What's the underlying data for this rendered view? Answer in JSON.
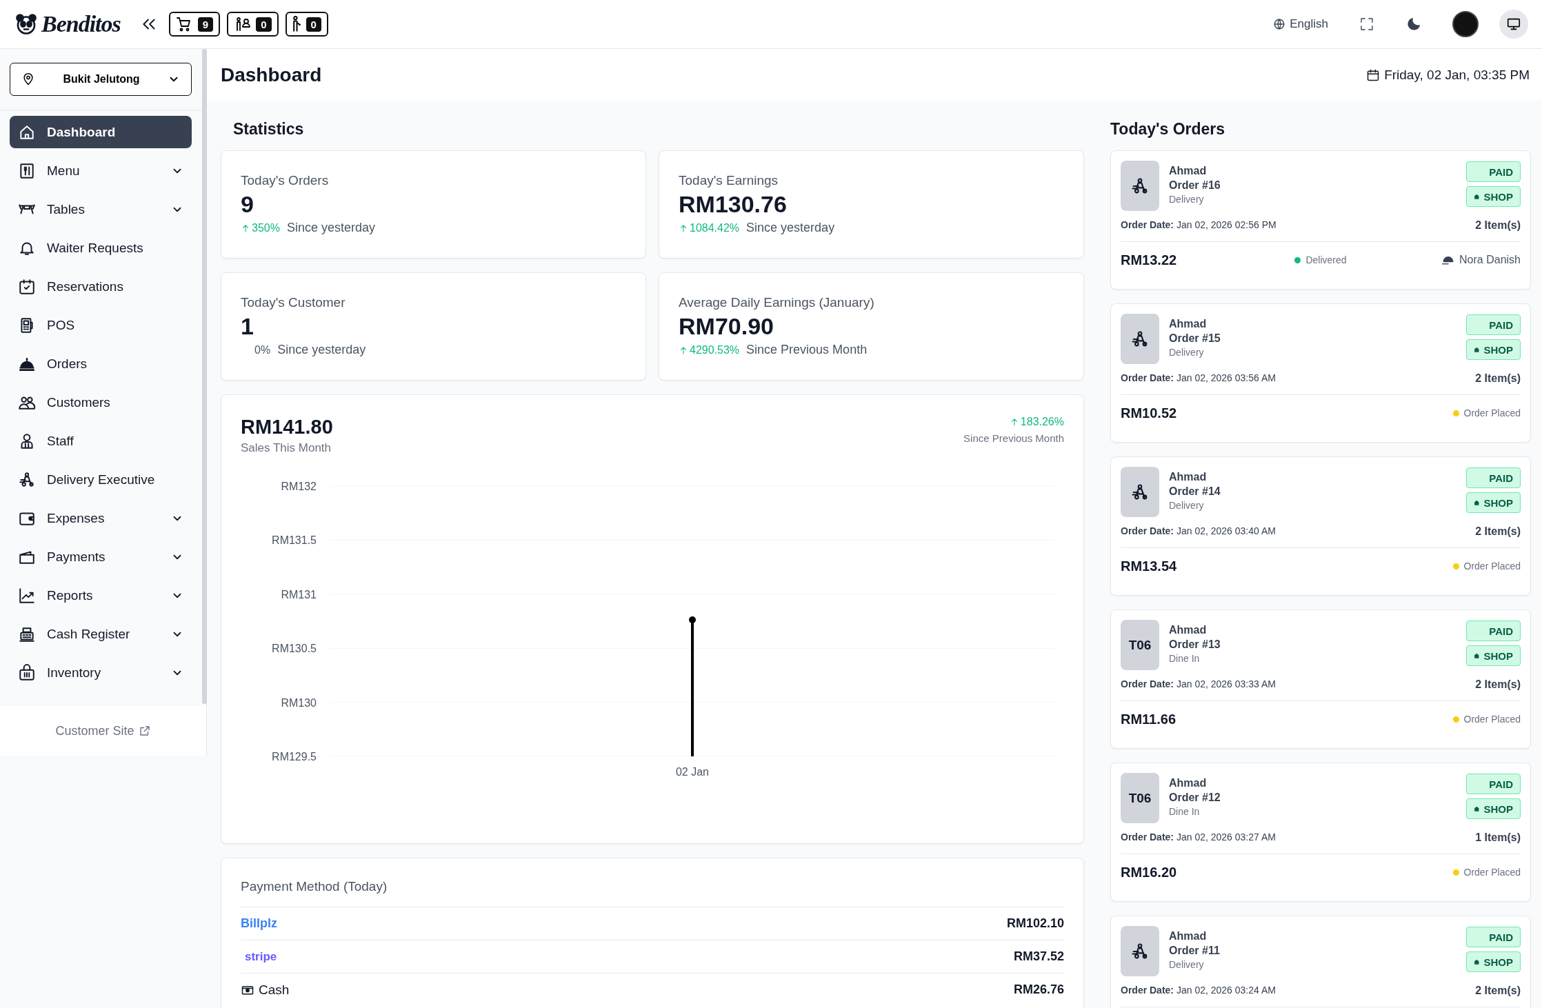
{
  "topbar": {
    "logo": "Benditos",
    "counters": [
      {
        "count": "9"
      },
      {
        "count": "0"
      },
      {
        "count": "0"
      }
    ],
    "language": "English"
  },
  "sidebar": {
    "location": "Bukit Jelutong",
    "items": [
      {
        "label": "Dashboard",
        "selected": true,
        "has_submenu": false
      },
      {
        "label": "Menu",
        "selected": false,
        "has_submenu": true
      },
      {
        "label": "Tables",
        "selected": false,
        "has_submenu": true
      },
      {
        "label": "Waiter Requests",
        "selected": false,
        "has_submenu": false
      },
      {
        "label": "Reservations",
        "selected": false,
        "has_submenu": false
      },
      {
        "label": "POS",
        "selected": false,
        "has_submenu": false
      },
      {
        "label": "Orders",
        "selected": false,
        "has_submenu": false
      },
      {
        "label": "Customers",
        "selected": false,
        "has_submenu": false
      },
      {
        "label": "Staff",
        "selected": false,
        "has_submenu": false
      },
      {
        "label": "Delivery Executive",
        "selected": false,
        "has_submenu": false
      },
      {
        "label": "Expenses",
        "selected": false,
        "has_submenu": true
      },
      {
        "label": "Payments",
        "selected": false,
        "has_submenu": true
      },
      {
        "label": "Reports",
        "selected": false,
        "has_submenu": true
      },
      {
        "label": "Cash Register",
        "selected": false,
        "has_submenu": true
      },
      {
        "label": "Inventory",
        "selected": false,
        "has_submenu": true
      }
    ],
    "footer_link": "Customer Site"
  },
  "header": {
    "title": "Dashboard",
    "datetime": "Friday, 02 Jan, 03:35 PM"
  },
  "statistics": {
    "title": "Statistics",
    "cards": [
      {
        "label": "Today's Orders",
        "value": "9",
        "change": "350%",
        "up": true,
        "note": "Since yesterday"
      },
      {
        "label": "Today's Earnings",
        "value": "RM130.76",
        "change": "1084.42%",
        "up": true,
        "note": "Since yesterday"
      },
      {
        "label": "Today's Customer",
        "value": "1",
        "change": "0%",
        "up": false,
        "note": "Since yesterday"
      },
      {
        "label": "Average Daily Earnings (January)",
        "value": "RM70.90",
        "change": "4290.53%",
        "up": true,
        "note": "Since Previous Month"
      }
    ]
  },
  "sales": {
    "value": "RM141.80",
    "label": "Sales This Month",
    "change": "183.26%",
    "note": "Since Previous Month",
    "chart": {
      "y_labels": [
        "RM132",
        "RM131.5",
        "RM131",
        "RM130.5",
        "RM130",
        "RM129.5"
      ],
      "x_labels": [
        "02 Jan"
      ]
    }
  },
  "payment_methods": {
    "title": "Payment Method (Today)",
    "rows": [
      {
        "kind": "billplz",
        "name": "Billplz",
        "amount": "RM102.10"
      },
      {
        "kind": "stripe",
        "name": "stripe",
        "amount": "RM37.52"
      },
      {
        "kind": "cash",
        "name": "Cash",
        "amount": "RM26.76"
      }
    ]
  },
  "todays_orders": {
    "title": "Today's Orders",
    "orders": [
      {
        "kind": "delivery",
        "customer": "Ahmad",
        "number": "Order #16",
        "type": "Delivery",
        "payment": "PAID",
        "source": "SHOP",
        "date_label": "Order Date:",
        "date": "Jan 02, 2026 02:56 PM",
        "items": "2 Item(s)",
        "total": "RM13.22",
        "status": "Delivered",
        "color": "#10b981",
        "driver": "Nora Danish"
      },
      {
        "kind": "delivery",
        "customer": "Ahmad",
        "number": "Order #15",
        "type": "Delivery",
        "payment": "PAID",
        "source": "SHOP",
        "date_label": "Order Date:",
        "date": "Jan 02, 2026 03:56 AM",
        "items": "2 Item(s)",
        "total": "RM10.52",
        "status": "Order Placed",
        "color": "#facc15"
      },
      {
        "kind": "delivery",
        "customer": "Ahmad",
        "number": "Order #14",
        "type": "Delivery",
        "payment": "PAID",
        "source": "SHOP",
        "date_label": "Order Date:",
        "date": "Jan 02, 2026 03:40 AM",
        "items": "2 Item(s)",
        "total": "RM13.54",
        "status": "Order Placed",
        "color": "#facc15"
      },
      {
        "kind": "table",
        "table": "T06",
        "customer": "Ahmad",
        "number": "Order #13",
        "type": "Dine In",
        "payment": "PAID",
        "source": "SHOP",
        "date_label": "Order Date:",
        "date": "Jan 02, 2026 03:33 AM",
        "items": "2 Item(s)",
        "total": "RM11.66",
        "status": "Order Placed",
        "color": "#facc15"
      },
      {
        "kind": "table",
        "table": "T06",
        "customer": "Ahmad",
        "number": "Order #12",
        "type": "Dine In",
        "payment": "PAID",
        "source": "SHOP",
        "date_label": "Order Date:",
        "date": "Jan 02, 2026 03:27 AM",
        "items": "1 Item(s)",
        "total": "RM16.20",
        "status": "Order Placed",
        "color": "#facc15"
      },
      {
        "kind": "delivery",
        "customer": "Ahmad",
        "number": "Order #11",
        "type": "Delivery",
        "payment": "PAID",
        "source": "SHOP",
        "date_label": "Order Date:",
        "date": "Jan 02, 2026 03:24 AM",
        "items": "2 Item(s)"
      }
    ]
  }
}
